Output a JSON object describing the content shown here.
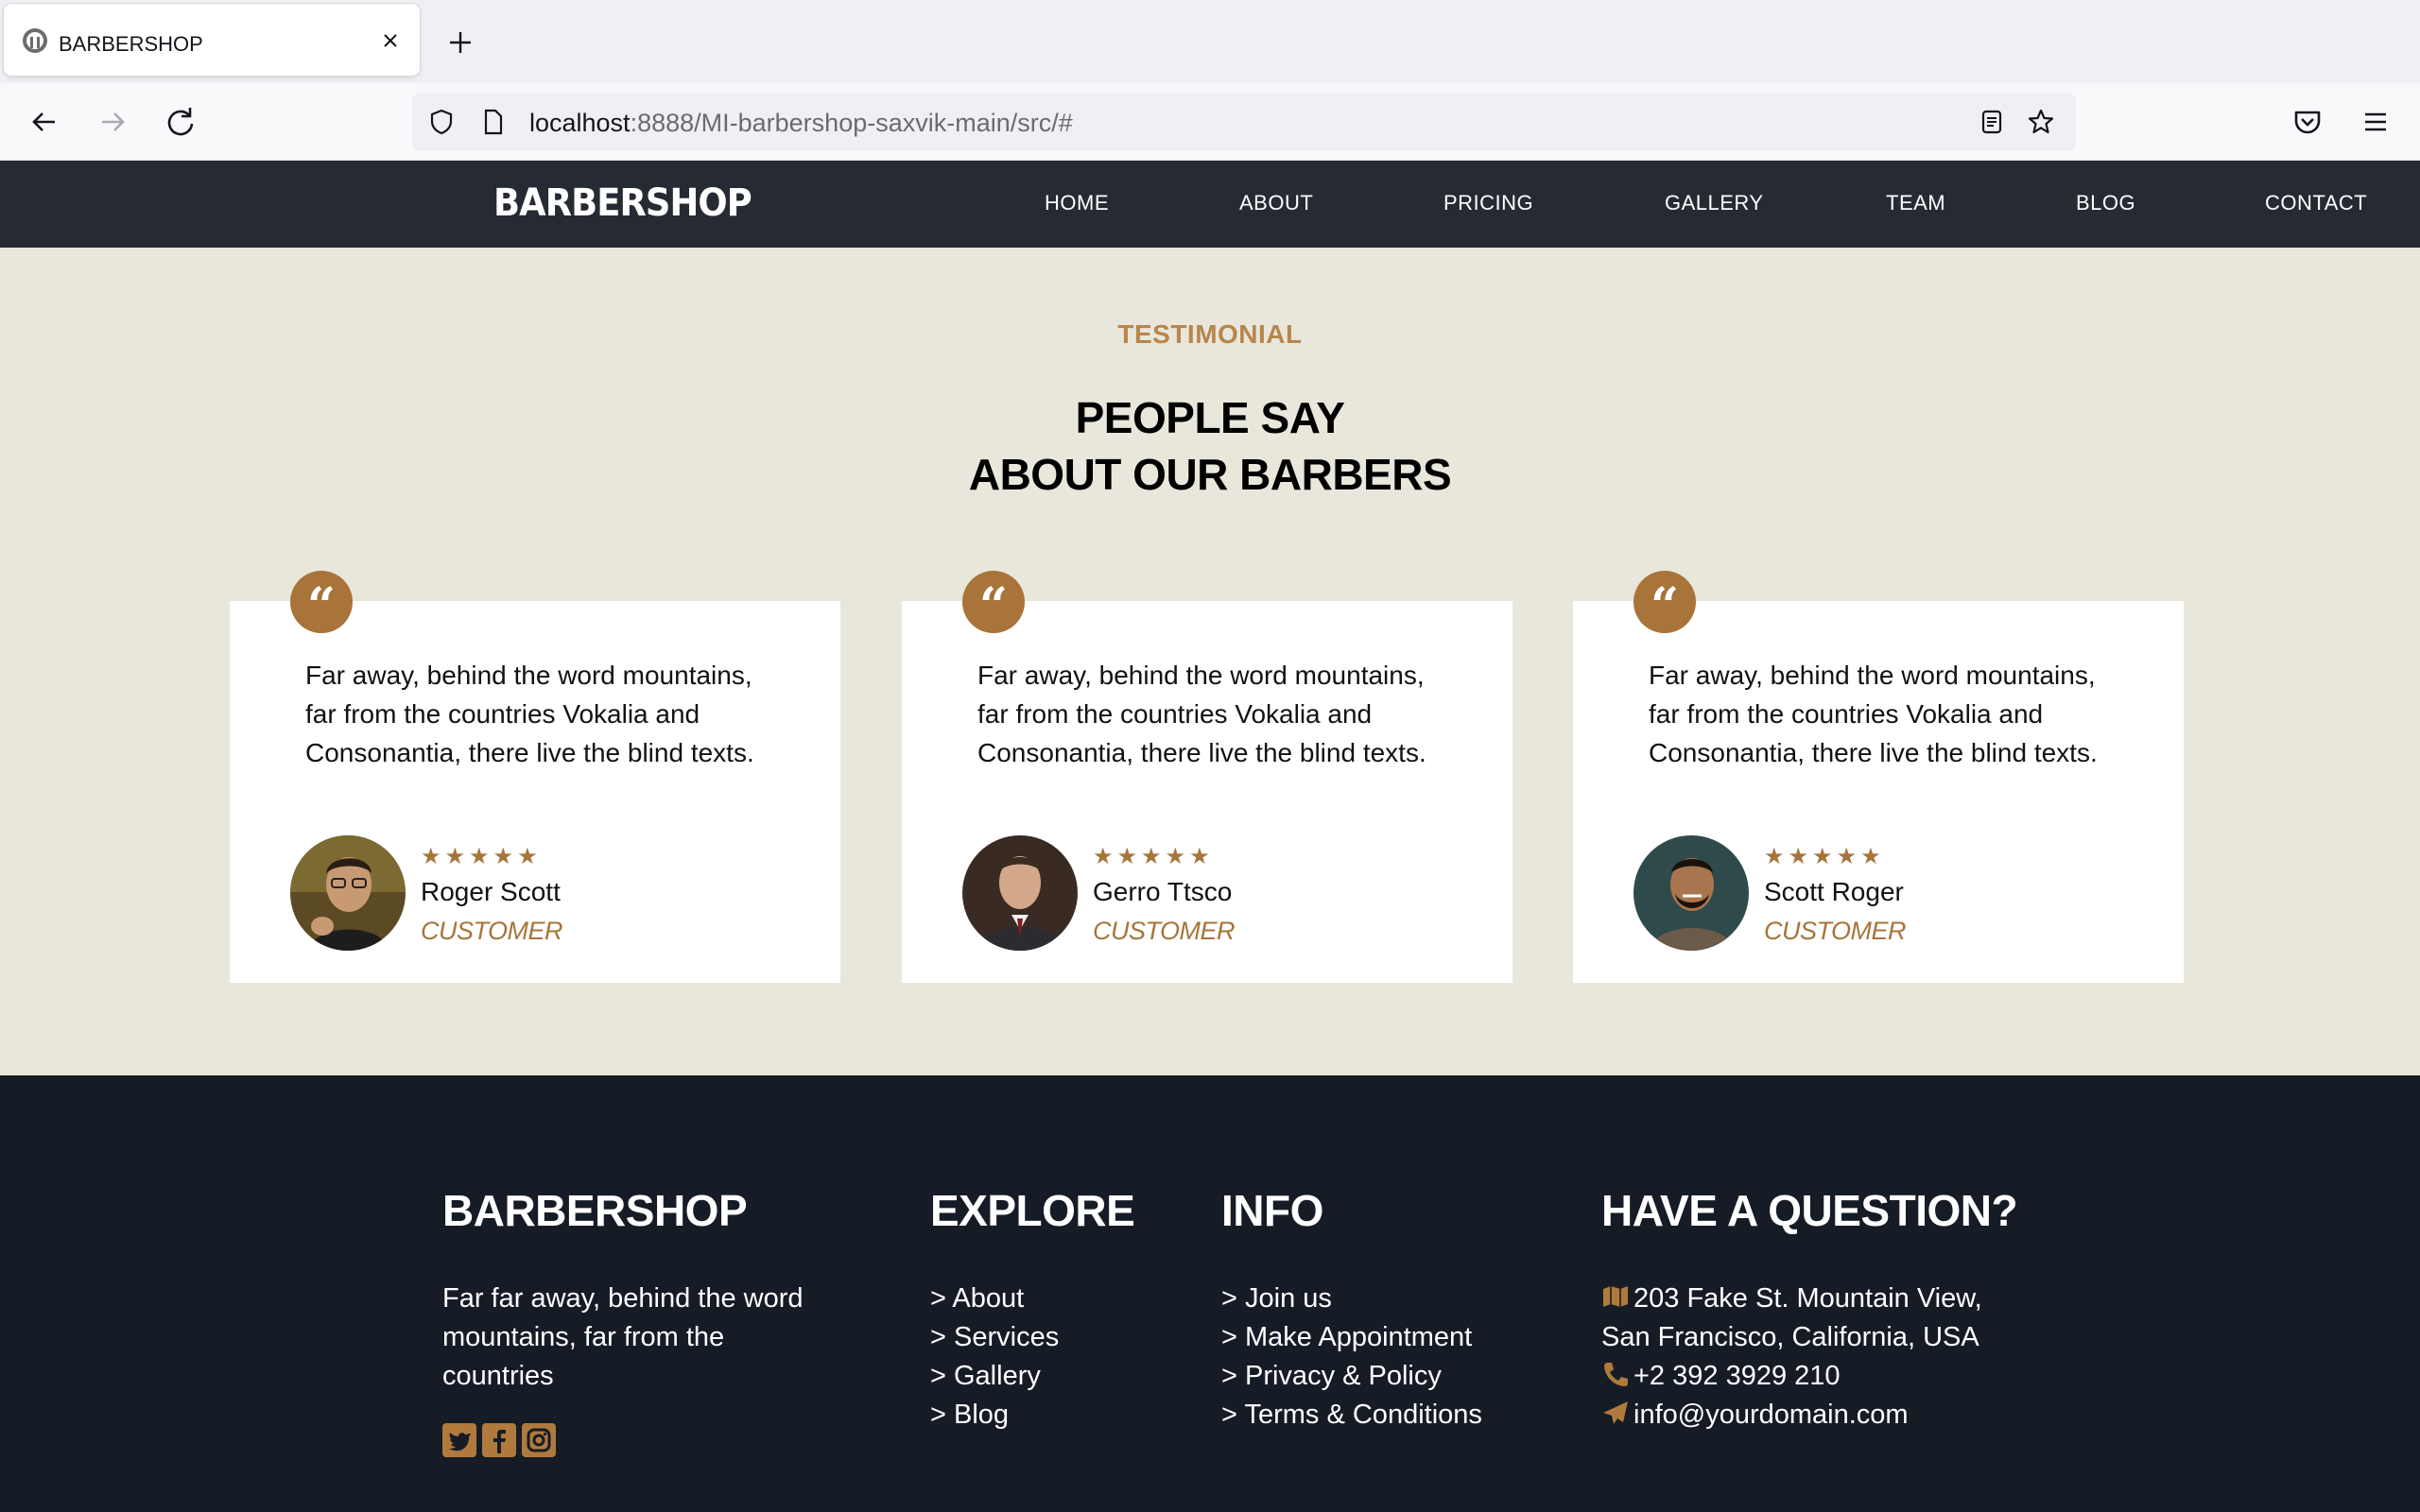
{
  "browser": {
    "tab_title": "BARBERSHOP",
    "url_host": "localhost",
    "url_rest": ":8888/MI-barbershop-saxvik-main/src/#"
  },
  "site": {
    "logo": "BARBERSHOP",
    "menu": [
      "HOME",
      "ABOUT",
      "PRICING",
      "GALLERY",
      "TEAM",
      "BLOG",
      "CONTACT"
    ]
  },
  "testimonials": {
    "subheading": "TESTIMONIAL",
    "heading_line1": "PEOPLE SAY",
    "heading_line2": "ABOUT OUR BARBERS",
    "cards": [
      {
        "text": "Far away, behind the word mountains, far from the countries Vokalia and Consonantia, there live the blind texts.",
        "stars": "★★★★★",
        "name": "Roger Scott",
        "role": "CUSTOMER"
      },
      {
        "text": "Far away, behind the word mountains, far from the countries Vokalia and Consonantia, there live the blind texts.",
        "stars": "★★★★★",
        "name": "Gerro Ttsco",
        "role": "CUSTOMER"
      },
      {
        "text": "Far away, behind the word mountains, far from the countries Vokalia and Consonantia, there live the blind texts.",
        "stars": "★★★★★",
        "name": "Scott Roger",
        "role": "CUSTOMER"
      }
    ]
  },
  "footer": {
    "brand_heading": "BARBERSHOP",
    "brand_text": "Far far away, behind the word mountains, far from the countries",
    "explore_heading": "EXPLORE",
    "explore_links": [
      "> About",
      "> Services",
      "> Gallery",
      "> Blog"
    ],
    "info_heading": "INFO",
    "info_links": [
      "> Join us",
      "> Make Appointment",
      "> Privacy & Policy",
      "> Terms & Conditions"
    ],
    "question_heading": "HAVE A QUESTION?",
    "address_line1": "203 Fake St. Mountain View,",
    "address_line2": "San Francisco, California, USA",
    "phone": "+2 392 3929 210",
    "email": "info@yourdomain.com",
    "social_icons": [
      "twitter-icon",
      "facebook-icon",
      "instagram-icon"
    ],
    "accent_color": "#b07a3c"
  }
}
